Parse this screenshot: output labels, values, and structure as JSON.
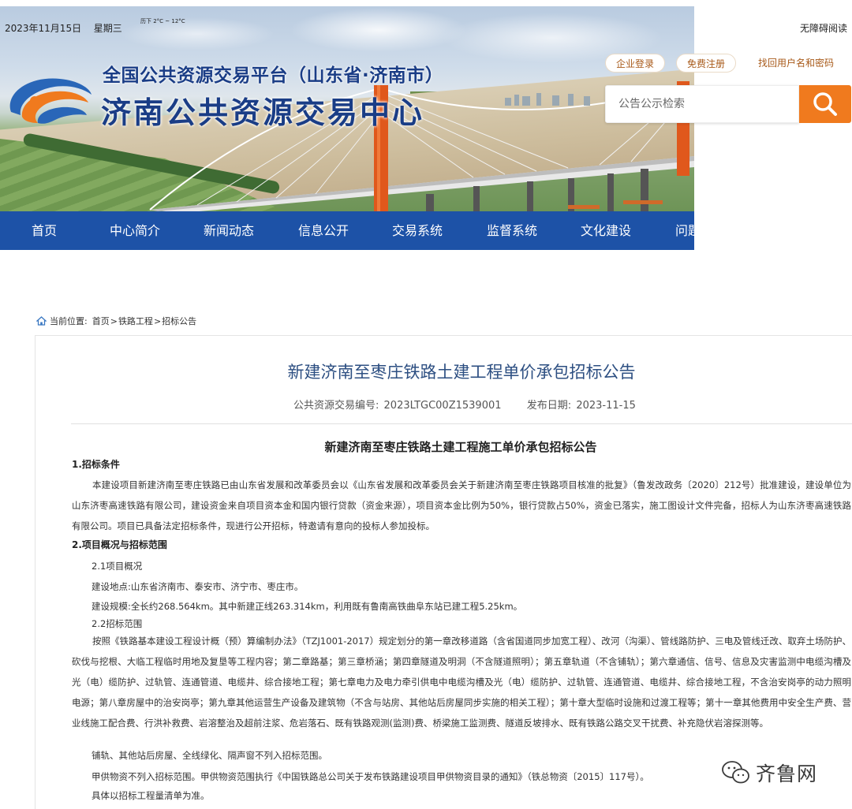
{
  "header": {
    "date": "2023年11月15日",
    "weekday": "星期三",
    "weather": "历下 2°C ~ 12°C",
    "platform_title": "全国公共资源交易平台（山东省·济南市）",
    "site_title": "济南公共资源交易中心"
  },
  "topbar": {
    "accessibility": "无障碍阅读",
    "login": "企业登录",
    "register": "免费注册",
    "recover": "找回用户名和密码",
    "search_placeholder": "公告公示检索"
  },
  "nav": {
    "items": [
      "首页",
      "中心简介",
      "新闻动态",
      "信息公开",
      "交易系统",
      "监督系统",
      "文化建设",
      "问题"
    ]
  },
  "breadcrumb": {
    "prefix": "当前位置:",
    "home": "首页",
    "section": "铁路工程",
    "page": "招标公告"
  },
  "article": {
    "title": "新建济南至枣庄铁路土建工程单价承包招标公告",
    "code_label": "公共资源交易编号:",
    "code": "2023LTGC00Z1539001",
    "date_label": "发布日期:",
    "date": "2023-11-15",
    "doc_title": "新建济南至枣庄铁路土建工程施工单价承包招标公告",
    "s1_heading": "1.招标条件",
    "s1_body": "本建设项目新建济南至枣庄铁路已由山东省发展和改革委员会以《山东省发展和改革委员会关于新建济南至枣庄铁路项目核准的批复》（鲁发改政务〔2020〕212号）批准建设，建设单位为山东济枣高速铁路有限公司，建设资金来自项目资本金和国内银行贷款（资金来源），项目资本金比例为50%，银行贷款占50%，资金已落实，施工图设计文件完备，招标人为山东济枣高速铁路有限公司。项目已具备法定招标条件，现进行公开招标，特邀请有意向的投标人参加投标。",
    "s2_heading": "2.项目概况与招标范围",
    "s21": "2.1项目概况",
    "location": "建设地点:山东省济南市、泰安市、济宁市、枣庄市。",
    "scale": "建设规模:全长约268.564km。其中新建正线263.314km，利用既有鲁南高铁曲阜东站已建工程5.25km。",
    "s22": "2.2招标范围",
    "scope": "按照《铁路基本建设工程设计概（预）算编制办法》（TZJ1001-2017）规定划分的第一章改移道路（含省国道同步加宽工程）、改河（沟渠）、管线路防护、三电及管线迁改、取弃土场防护、砍伐与挖根、大临工程临时用地及复垦等工程内容；第二章路基；第三章桥涵；第四章隧道及明洞（不含隧道照明）；第五章轨道（不含铺轨）；第六章通信、信号、信息及灾害监测中电缆沟槽及光（电）缆防护、过轨管、连通管道、电缆井、综合接地工程；第七章电力及电力牵引供电中电缆沟槽及光（电）缆防护、过轨管、连通管道、电缆井、综合接地工程，不含治安岗亭的动力照明电源；第八章房屋中的治安岗亭；第九章其他运营生产设备及建筑物（不含与站房、其他站后房屋同步实施的相关工程）；第十章大型临时设施和过渡工程等；第十一章其他费用中安全生产费、营业线施工配合费、行洪补救费、岩溶整治及超前注浆、危岩落石、既有铁路观测(监测)费、桥梁施工监测费、隧道反坡排水、既有铁路公路交叉干扰费、补充隐伏岩溶探测等。",
    "excl1": "铺轨、其他站后房屋、全线绿化、隔声窗不列入招标范围。",
    "excl2": "甲供物资不列入招标范围。甲供物资范围执行《中国铁路总公司关于发布铁路建设项目甲供物资目录的通知》（铁总物资〔2015〕117号）。",
    "excl3": "具体以招标工程量清单为准。"
  },
  "watermark": {
    "text": "齐鲁网"
  },
  "colors": {
    "nav_bg": "#1d52a7",
    "search_button": "#f07a1e",
    "title_blue": "#2d4f82",
    "brand_blue": "#1a3d86"
  }
}
